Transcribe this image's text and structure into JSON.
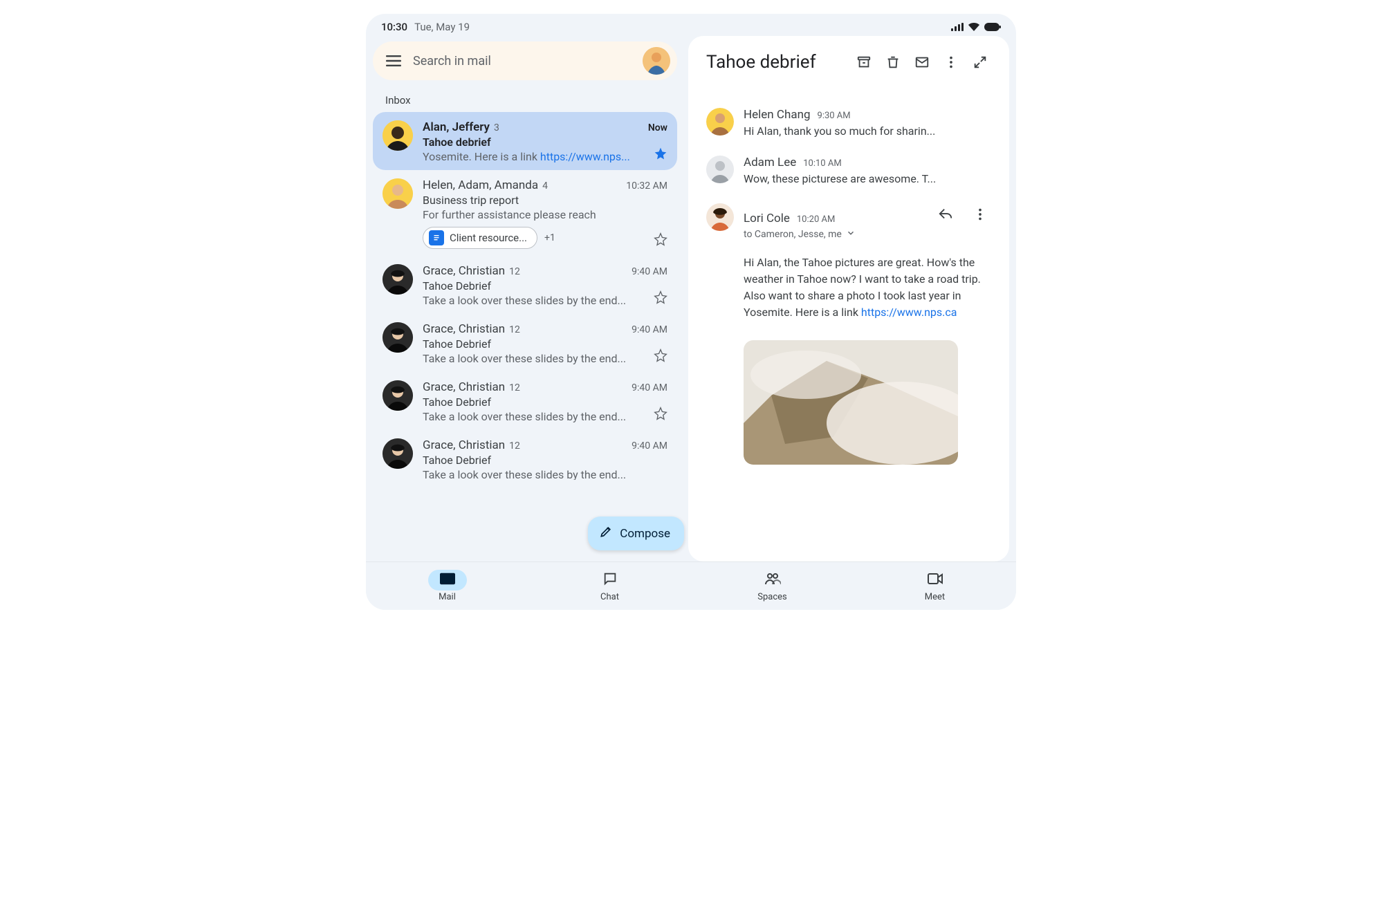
{
  "statusbar": {
    "time": "10:30",
    "date": "Tue, May 19"
  },
  "search": {
    "placeholder": "Search in mail"
  },
  "inbox": {
    "title": "Inbox",
    "threads": [
      {
        "participants": "Alan, Jeffery",
        "count": "3",
        "time": "Now",
        "subject": "Tahoe debrief",
        "snippet": "Yosemite. Here is a link ",
        "snippet_link": "https://www.nps...",
        "unread": true,
        "selected": true,
        "starred": true
      },
      {
        "participants": "Helen, Adam, Amanda",
        "count": "4",
        "time": "10:32 AM",
        "subject": "Business trip report",
        "snippet": "For further assistance please reach",
        "attachment_label": "Client resource...",
        "attachment_extra": "+1"
      },
      {
        "participants": "Grace, Christian",
        "count": "12",
        "time": "9:40 AM",
        "subject": "Tahoe Debrief",
        "snippet": "Take a look over these slides by the end..."
      },
      {
        "participants": "Grace, Christian",
        "count": "12",
        "time": "9:40 AM",
        "subject": "Tahoe Debrief",
        "snippet": "Take a look over these slides by the end..."
      },
      {
        "participants": "Grace, Christian",
        "count": "12",
        "time": "9:40 AM",
        "subject": "Tahoe Debrief",
        "snippet": "Take a look over these slides by the end..."
      },
      {
        "participants": "Grace, Christian",
        "count": "12",
        "time": "9:40 AM",
        "subject": "Tahoe Debrief",
        "snippet": "Take a look over these slides by the end..."
      }
    ]
  },
  "compose_label": "Compose",
  "nav": {
    "mail": "Mail",
    "chat": "Chat",
    "spaces": "Spaces",
    "meet": "Meet"
  },
  "reading": {
    "title": "Tahoe debrief",
    "messages": [
      {
        "sender": "Helen Chang",
        "time": "9:30 AM",
        "preview": "Hi Alan, thank you so much for sharin..."
      },
      {
        "sender": "Adam Lee",
        "time": "10:10 AM",
        "preview": "Wow, these picturese are awesome. T..."
      },
      {
        "sender": "Lori Cole",
        "time": "10:20 AM",
        "recipients": "to Cameron, Jesse, me",
        "body_text": "Hi Alan, the Tahoe pictures are great. How's the weather in Tahoe now? I want to take a road trip. Also want to share a photo I took last year in Yosemite. Here is a link ",
        "body_link": "https://www.nps.ca"
      }
    ]
  }
}
